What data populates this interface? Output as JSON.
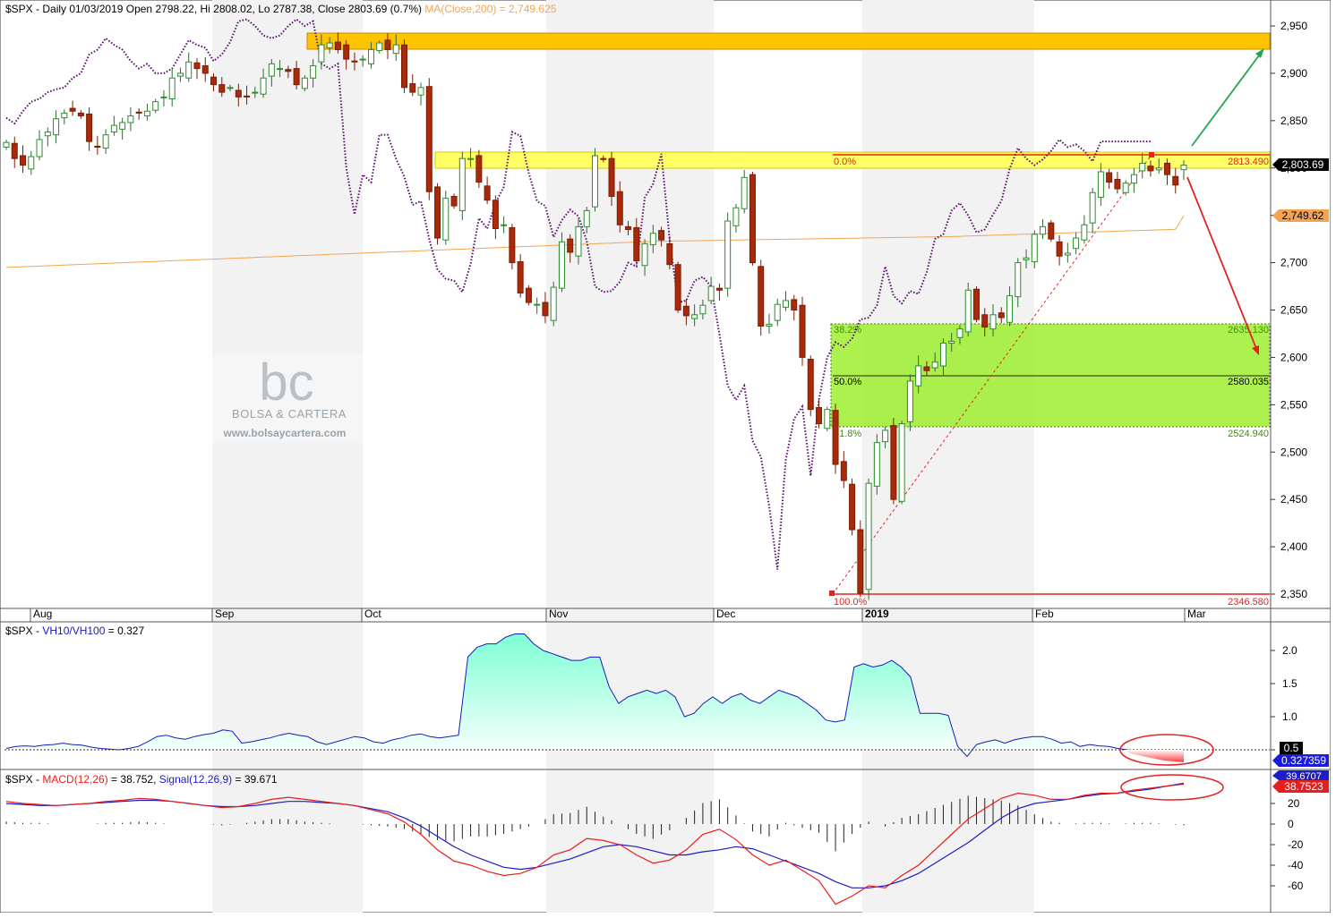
{
  "panels": {
    "price": {
      "symbol": "$SPX",
      "label_main": "$SPX - Daily 01/03/2019 Open 2798.22, Hi 2808.02, Lo 2787.38, Close 2803.69 (0.7%)",
      "label_ma": "MA(Close,200) = 2,749.625",
      "last_close_tag": "2,803.69",
      "ma_tag": "2,749.62",
      "y_ticks": [
        "2,950",
        "2,900",
        "2,850",
        "2,800",
        "2,750",
        "2,700",
        "2,650",
        "2,600",
        "2,550",
        "2,500",
        "2,450",
        "2,400",
        "2,350"
      ],
      "fib_labels": {
        "l0": "0.0%",
        "v0": "2813.490",
        "l382": "38.2%",
        "v382": "2635.130",
        "l50": "50.0%",
        "v50": "2580.035",
        "l618": "61.8%",
        "v618": "2524.940",
        "l100": "100.0%",
        "v100": "2346.580"
      }
    },
    "vh": {
      "label_a": "$SPX - ",
      "label_b": "VH10/VH100",
      "label_c": " = 0.327",
      "y_ticks": [
        "2.0",
        "1.5",
        "1.0",
        "0.5"
      ],
      "tag_ref": "0.5",
      "tag_val": "0.327359"
    },
    "macd": {
      "label_a": "$SPX - ",
      "label_b": "MACD(12,26)",
      "label_c": " = 38.752, ",
      "label_d": "Signal(12,26,9)",
      "label_e": " = 39.671",
      "y_ticks": [
        "20",
        "0",
        "-20",
        "-40",
        "-60"
      ],
      "tag_signal": "39.6707",
      "tag_macd": "38.7523"
    }
  },
  "x_axis": [
    "Aug",
    "Sep",
    "Oct",
    "Nov",
    "Dec",
    "2019",
    "Feb",
    "Mar"
  ],
  "watermark": {
    "logo": "bc",
    "name": "BOLSA & CARTERA",
    "url": "www.bolsaycartera.com"
  },
  "colors": {
    "up": "#2e8b2e",
    "down": "#a82a0a",
    "ma": "#f4a451",
    "resistance_top": "#ffc400",
    "resistance_mid": "#ffff66",
    "fib_zone": "#99ee22",
    "vh_fill": "#7dffd4",
    "macd": "#e81d1d",
    "signal": "#1c1cc8"
  },
  "chart_data": [
    {
      "type": "candlestick",
      "title": "$SPX - Daily 01/03/2019 Open 2798.22, Hi 2808.02, Lo 2787.38, Close 2803.69 (0.7%)",
      "series": [
        {
          "name": "MA(Close,200)",
          "last": 2749.625
        }
      ],
      "ylim": [
        2330,
        2970
      ],
      "last": {
        "open": 2798.22,
        "high": 2808.02,
        "low": 2787.38,
        "close": 2803.69
      },
      "closes": [
        2827,
        2810,
        2803,
        2812,
        2830,
        2838,
        2852,
        2858,
        2860,
        2855,
        2828,
        2822,
        2835,
        2845,
        2848,
        2855,
        2858,
        2860,
        2870,
        2875,
        2895,
        2900,
        2912,
        2905,
        2900,
        2888,
        2880,
        2885,
        2875,
        2875,
        2880,
        2895,
        2910,
        2905,
        2902,
        2888,
        2895,
        2908,
        2930,
        2932,
        2925,
        2915,
        2912,
        2915,
        2925,
        2932,
        2925,
        2930,
        2885,
        2880,
        2885,
        2775,
        2726,
        2768,
        2760,
        2810,
        2810,
        2785,
        2766,
        2736,
        2740,
        2700,
        2668,
        2658,
        2656,
        2644,
        2674,
        2722,
        2711,
        2738,
        2755,
        2813,
        2809,
        2770,
        2740,
        2735,
        2702,
        2720,
        2731,
        2724,
        2698,
        2650,
        2644,
        2645,
        2655,
        2675,
        2671,
        2744,
        2758,
        2790,
        2700,
        2633,
        2635,
        2656,
        2660,
        2650,
        2600,
        2545,
        2530,
        2545,
        2487,
        2470,
        2418,
        2351,
        2467,
        2510,
        2523,
        2450,
        2530,
        2575,
        2591,
        2586,
        2595,
        2615,
        2617,
        2630,
        2671,
        2640,
        2632,
        2645,
        2642,
        2665,
        2700,
        2705,
        2730,
        2738,
        2725,
        2707,
        2710,
        2726,
        2740,
        2774,
        2796,
        2785,
        2778,
        2784,
        2793,
        2805,
        2797,
        2800,
        2793,
        2782,
        2803
      ]
    },
    {
      "type": "area",
      "title": "VH10/VH100",
      "ylim": [
        0.3,
        2.3
      ],
      "series": [
        {
          "name": "VH10/VH100",
          "last": 0.327
        }
      ],
      "reference": 0.5,
      "values": [
        0.52,
        0.55,
        0.56,
        0.55,
        0.57,
        0.58,
        0.6,
        0.58,
        0.57,
        0.54,
        0.52,
        0.51,
        0.5,
        0.52,
        0.55,
        0.62,
        0.7,
        0.72,
        0.68,
        0.66,
        0.7,
        0.73,
        0.75,
        0.8,
        0.78,
        0.6,
        0.62,
        0.65,
        0.68,
        0.72,
        0.75,
        0.72,
        0.7,
        0.62,
        0.58,
        0.62,
        0.66,
        0.7,
        0.68,
        0.62,
        0.6,
        0.65,
        0.68,
        0.72,
        0.74,
        0.7,
        0.68,
        0.7,
        0.72,
        1.9,
        2.05,
        2.1,
        2.1,
        2.2,
        2.25,
        2.25,
        2.1,
        2.0,
        1.95,
        1.9,
        1.85,
        1.85,
        1.9,
        1.9,
        1.45,
        1.2,
        1.3,
        1.35,
        1.4,
        1.35,
        1.4,
        1.3,
        1.0,
        1.05,
        1.2,
        1.3,
        1.2,
        1.3,
        1.35,
        1.25,
        1.2,
        1.3,
        1.4,
        1.35,
        1.3,
        1.2,
        1.1,
        0.95,
        0.92,
        0.95,
        1.75,
        1.8,
        1.75,
        1.78,
        1.85,
        1.75,
        1.6,
        1.05,
        1.05,
        1.05,
        1.02,
        0.55,
        0.4,
        0.58,
        0.62,
        0.65,
        0.6,
        0.65,
        0.68,
        0.7,
        0.7,
        0.66,
        0.6,
        0.62,
        0.55,
        0.58,
        0.56,
        0.55,
        0.52,
        0.5,
        0.45,
        0.42,
        0.4,
        0.38,
        0.35,
        0.33
      ]
    },
    {
      "type": "line",
      "title": "MACD(12,26) / Signal(12,26,9)",
      "ylim": [
        -80,
        45
      ],
      "series": [
        {
          "name": "MACD(12,26)",
          "last": 38.752,
          "values": [
            22,
            20,
            19,
            18,
            19,
            20,
            22,
            23,
            25,
            24,
            22,
            20,
            18,
            16,
            17,
            20,
            24,
            26,
            24,
            22,
            20,
            18,
            14,
            10,
            2,
            -10,
            -25,
            -36,
            -40,
            -46,
            -50,
            -48,
            -42,
            -30,
            -25,
            -14,
            -16,
            -20,
            -30,
            -38,
            -35,
            -25,
            -10,
            -5,
            -15,
            -30,
            -40,
            -35,
            -45,
            -55,
            -78,
            -70,
            -60,
            -62,
            -50,
            -40,
            -25,
            -10,
            5,
            15,
            25,
            30,
            28,
            24,
            24,
            28,
            30,
            30,
            33,
            35,
            37,
            38.752
          ]
        },
        {
          "name": "Signal(12,26,9)",
          "last": 39.671,
          "values": [
            20,
            19,
            18,
            18,
            19,
            20,
            21,
            22,
            23,
            23,
            22,
            20,
            18,
            17,
            17,
            18,
            20,
            22,
            22,
            21,
            20,
            18,
            15,
            12,
            6,
            -2,
            -12,
            -22,
            -30,
            -36,
            -42,
            -44,
            -42,
            -38,
            -34,
            -28,
            -22,
            -20,
            -22,
            -26,
            -30,
            -30,
            -27,
            -25,
            -22,
            -24,
            -30,
            -36,
            -42,
            -48,
            -56,
            -62,
            -62,
            -60,
            -55,
            -48,
            -38,
            -28,
            -18,
            -6,
            6,
            15,
            20,
            22,
            24,
            27,
            29,
            30,
            32,
            34,
            37,
            39.671
          ]
        }
      ]
    }
  ]
}
